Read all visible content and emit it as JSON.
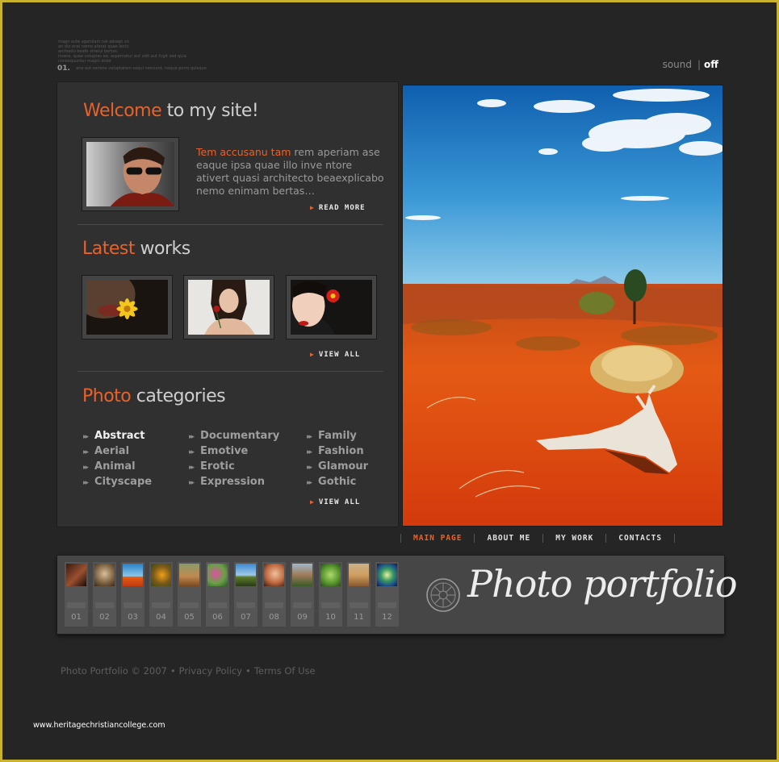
{
  "top": {
    "tiny_lines": [
      "magn aute agendam nei adsept vo",
      "an dio erat nemo aterat quae lectu",
      "archiedu beafe stratui bertas.",
      "incere, quae voluptas eo, aspernatur aut odit aut fugit sed quia",
      "consequuntur magni dolor"
    ],
    "number": "01.",
    "number_text": "ane aut serisne voluptatem sequi nesciunt, neque porro quisque",
    "sound_label": "sound",
    "sound_separator": "|",
    "sound_value": "off"
  },
  "welcome": {
    "accent": "Welcome",
    "rest": " to my site!",
    "intro_accent": "Tem accusanu tam",
    "intro_text": " rem aperiam ase eaque ipsa quae illo inve ntore ativert quasi architecto beaexplicabo nemo enimam bertas…",
    "read_more": "READ MORE"
  },
  "latest": {
    "accent": "Latest",
    "rest": " works",
    "view_all": "VIEW ALL"
  },
  "categories": {
    "accent": "Photo",
    "rest": " categories",
    "columns": [
      [
        "Abstract",
        "Aerial",
        "Animal",
        "Cityscape"
      ],
      [
        "Documentary",
        "Emotive",
        "Erotic",
        "Expression"
      ],
      [
        "Family",
        "Fashion",
        "Glamour",
        "Gothic"
      ]
    ],
    "view_all": "VIEW ALL"
  },
  "nav": [
    "MAIN PAGE",
    "ABOUT ME",
    "MY WORK",
    "CONTACTS"
  ],
  "thumbs": [
    "01",
    "02",
    "03",
    "04",
    "05",
    "06",
    "07",
    "08",
    "09",
    "10",
    "11",
    "12"
  ],
  "logo_text": "Photo portfolio",
  "footer": {
    "copyright": "Photo Portfolio © 2007",
    "privacy": "Privacy Policy",
    "terms": "Terms Of Use"
  },
  "watermark": "www.heritagechristiancollege.com",
  "colors": {
    "accent": "#e8622a",
    "background": "#252525",
    "panel": "#303030",
    "frame": "#c9b22e"
  }
}
